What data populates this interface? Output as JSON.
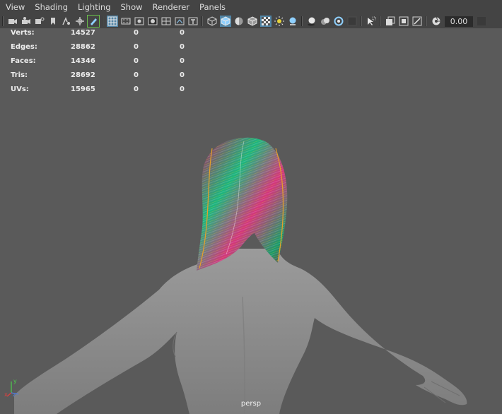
{
  "menu": {
    "items": [
      "View",
      "Shading",
      "Lighting",
      "Show",
      "Renderer",
      "Panels"
    ]
  },
  "toolbar": {
    "exposure_value": "0.00",
    "icons": {
      "camera": "camera-icon",
      "camera_attributes": "camera-attributes-icon",
      "camera_bookmark": "bookmark-icon",
      "image_plane": "image-plane-icon",
      "grease_pencil": "grease-pencil-icon",
      "grid": "grid-icon",
      "film_gate": "film-gate-icon",
      "resolution_gate": "resolution-gate-icon",
      "field_chart": "field-chart-icon",
      "safe_action": "safe-action-icon",
      "safe_title": "safe-title-icon",
      "wireframe": "wireframe-icon",
      "smooth_shade": "smooth-shade-icon",
      "default_material": "default-material-icon",
      "xray": "xray-icon",
      "textured": "textured-icon",
      "lights": "lights-icon",
      "shadows": "shadows-icon",
      "ambient_occlusion": "ambient-occlusion-icon",
      "motion_blur": "motion-blur-icon",
      "isolate": "isolate-icon",
      "exposure": "exposure-icon"
    }
  },
  "hud": {
    "rows": [
      {
        "label": "Verts:",
        "values": [
          "14527",
          "0",
          "0"
        ]
      },
      {
        "label": "Edges:",
        "values": [
          "28862",
          "0",
          "0"
        ]
      },
      {
        "label": "Faces:",
        "values": [
          "14346",
          "0",
          "0"
        ]
      },
      {
        "label": "Tris:",
        "values": [
          "28692",
          "0",
          "0"
        ]
      },
      {
        "label": "UVs:",
        "values": [
          "15965",
          "0",
          "0"
        ]
      }
    ]
  },
  "viewport": {
    "camera_label": "persp",
    "axis_labels": {
      "x": "x",
      "y": "y",
      "z": "z"
    },
    "colors": {
      "background": "#5a5a5a",
      "body": "#8e8e8e",
      "active_button": "#5285a6",
      "hair": [
        "#c2185b",
        "#1bb67e",
        "#e6d23a",
        "#8e1b3c"
      ]
    }
  }
}
